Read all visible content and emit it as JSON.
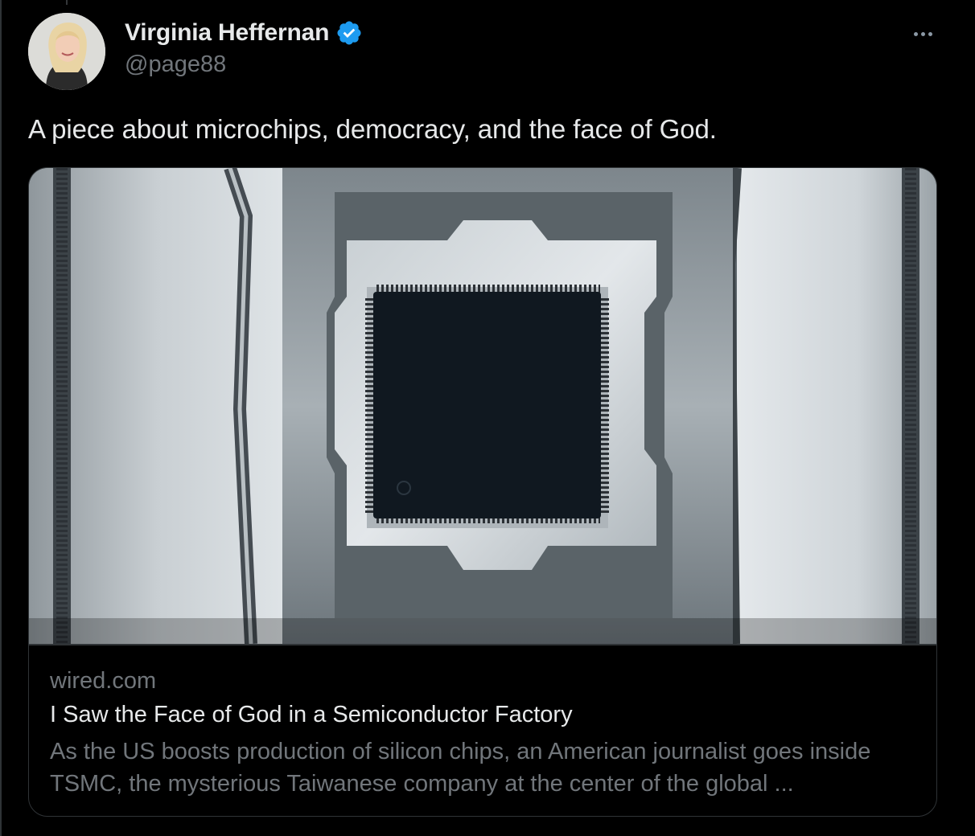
{
  "author": {
    "display_name": "Virginia Heffernan",
    "handle": "@page88",
    "verified": true
  },
  "icons": {
    "verified": "verified-badge-icon",
    "more": "more-options-icon"
  },
  "tweet": {
    "text": "A piece about microchips, democracy, and the face of God."
  },
  "link_card": {
    "domain": "wired.com",
    "title": "I Saw the Face of God in a Semiconductor Factory",
    "description": "As the US boosts production of silicon chips, an American journalist goes inside TSMC, the mysterious Taiwanese company at the center of the global ...",
    "image_alt": "Microchip in a metal socket"
  },
  "colors": {
    "background": "#000000",
    "text": "#e7e9ea",
    "muted": "#71767b",
    "border": "#2f3336",
    "verified_blue": "#1d9bf0"
  }
}
